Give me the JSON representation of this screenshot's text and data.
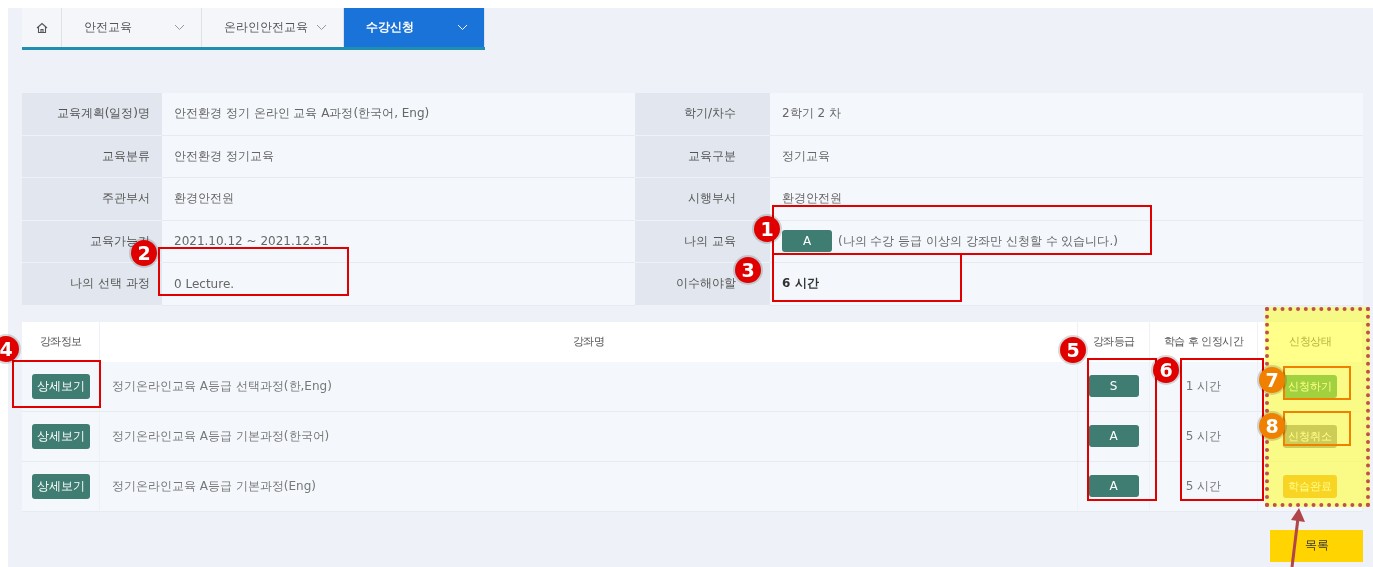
{
  "breadcrumb": [
    {
      "kind": "home",
      "selected": false
    },
    {
      "kind": "menu",
      "label": "안전교육",
      "selected": false
    },
    {
      "kind": "menu",
      "label": "온라인안전교육",
      "selected": false
    },
    {
      "kind": "menu",
      "label": "수강신청",
      "selected": true
    }
  ],
  "info_rows": [
    {
      "label": "교육계획(일정)명",
      "value": "안전환경 정기 온라인 교육 A과정(한국어, Eng)",
      "label_2": "학기/차수",
      "value_2": "2학기  2 차"
    },
    {
      "label": "교육분류",
      "value": "안전환경 정기교육",
      "label_2": "교육구분",
      "value_2": "정기교육"
    },
    {
      "label": "주관부서",
      "value": "환경안전원",
      "label_2": "시행부서",
      "value_2": "환경안전원"
    },
    {
      "label": "교육가능기",
      "value": "2021.10.12 ~ 2021.12.31",
      "label_2": "나의 교육",
      "grade": "A",
      "note": "(나의 수강 등급 이상의 강좌만 신청할 수 있습니다.)"
    },
    {
      "label": "나의 선택 과정",
      "value": "0 Lecture.",
      "label_2": "이수해야할",
      "value_2": "6 시간",
      "bold_2": true
    }
  ],
  "course_table": {
    "columns": [
      "강좌정보",
      "강좌명",
      "강좌등급",
      "학습 후 인정시간",
      "신청상태"
    ],
    "rows": [
      {
        "detail": "상세보기",
        "name": "정기온라인교육 A등급 선택과정(한,Eng)",
        "grade": "S",
        "hours": "1 시간",
        "status": {
          "kind": "apply",
          "label": "신청하기"
        }
      },
      {
        "detail": "상세보기",
        "name": "정기온라인교육 A등급 기본과정(한국어)",
        "grade": "A",
        "hours": "5 시간",
        "status": {
          "kind": "cancel",
          "label": "신청취소"
        }
      },
      {
        "detail": "상세보기",
        "name": "정기온라인교육 A등급 기본과정(Eng)",
        "grade": "A",
        "hours": "5 시간",
        "status": {
          "kind": "done",
          "label": "학습완료"
        }
      }
    ]
  },
  "list_button": "목록",
  "annotations": [
    {
      "label": "1",
      "color": "#e00000"
    },
    {
      "label": "2",
      "color": "#e00000"
    },
    {
      "label": "3",
      "color": "#e00000"
    },
    {
      "label": "4",
      "color": "#e00000"
    },
    {
      "label": "5",
      "color": "#e00000"
    },
    {
      "label": "6",
      "color": "#e00000"
    },
    {
      "label": "7",
      "color": "#f08000"
    },
    {
      "label": "8",
      "color": "#f08000"
    }
  ]
}
